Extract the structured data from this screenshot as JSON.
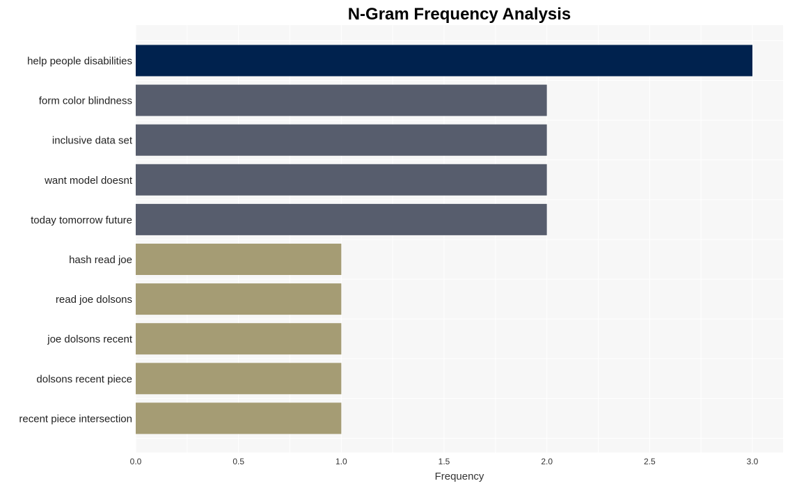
{
  "chart_data": {
    "type": "bar",
    "orientation": "horizontal",
    "title": "N-Gram Frequency Analysis",
    "xlabel": "Frequency",
    "ylabel": "",
    "xlim": [
      0,
      3.15
    ],
    "xticks": [
      "0.0",
      "0.5",
      "1.0",
      "1.5",
      "2.0",
      "2.5",
      "3.0"
    ],
    "grid": true,
    "categories": [
      "help people disabilities",
      "form color blindness",
      "inclusive data set",
      "want model doesnt",
      "today tomorrow future",
      "hash read joe",
      "read joe dolsons",
      "joe dolsons recent",
      "dolsons recent piece",
      "recent piece intersection"
    ],
    "values": [
      3,
      2,
      2,
      2,
      2,
      1,
      1,
      1,
      1,
      1
    ],
    "colors": [
      "#00224e",
      "#575d6d",
      "#575d6d",
      "#575d6d",
      "#575d6d",
      "#a59c74",
      "#a59c74",
      "#a59c74",
      "#a59c74",
      "#a59c74"
    ],
    "background": "#f7f7f7"
  }
}
